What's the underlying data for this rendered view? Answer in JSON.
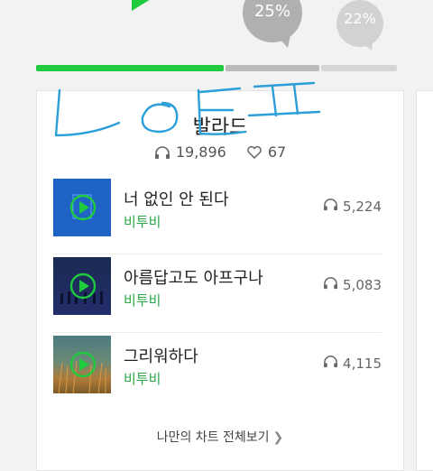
{
  "colors": {
    "accent": "#1ecb3c",
    "bar_gray": "#bbbbbb",
    "bar_light": "#d6d6d6",
    "artist": "#2aa84a",
    "ink": "#2a9fd8"
  },
  "vote": {
    "options": [
      {
        "pct_label": "",
        "color": "#1ecb3c"
      },
      {
        "pct_label": "25%",
        "color": "#b0b0b0"
      },
      {
        "pct_label": "22%",
        "color": "#d2d2d2"
      }
    ]
  },
  "card": {
    "title": "발라드",
    "listens": "19,896",
    "likes": "67",
    "songs": [
      {
        "title": "너 없인 안 된다",
        "artist": "비투비",
        "plays": "5,224",
        "cover": "blue"
      },
      {
        "title": "아름답고도 아프구나",
        "artist": "비투비",
        "plays": "5,083",
        "cover": "navy"
      },
      {
        "title": "그리워하다",
        "artist": "비투비",
        "plays": "4,115",
        "cover": "field"
      }
    ],
    "more_label": "나만의 차트 전체보기",
    "more_icon": "chevron-right-icon"
  },
  "icons": {
    "headphones": "headphones-icon",
    "heart": "heart-icon",
    "play": "play-icon"
  }
}
